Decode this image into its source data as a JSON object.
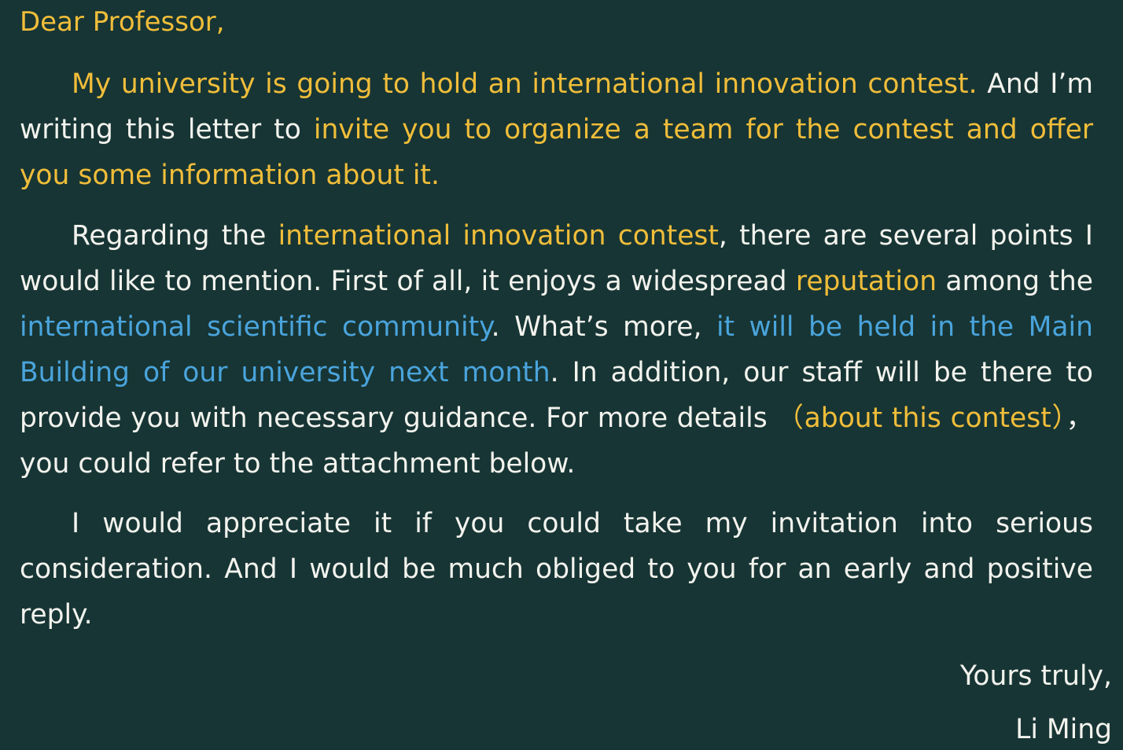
{
  "colors": {
    "background": "#173534",
    "text": "#f3f3ee",
    "highlight_yellow": "#f0bd3a",
    "highlight_blue": "#4aa4dc"
  },
  "letter": {
    "salutation": "Dear Professor,",
    "paragraph1": [
      {
        "text": "My university is going to hold an international innovation contest.",
        "style": "yellow"
      },
      {
        "text": " And I’m writing this letter to ",
        "style": "plain"
      },
      {
        "text": "invite you to organize a team for the contest and offer you some information about it.",
        "style": "yellow"
      }
    ],
    "paragraph2": [
      {
        "text": "Regarding the ",
        "style": "plain"
      },
      {
        "text": "international innovation contest",
        "style": "yellow"
      },
      {
        "text": ", there are several points I would like to mention. First of all, it enjoys a widespread ",
        "style": "plain"
      },
      {
        "text": "reputation",
        "style": "yellow"
      },
      {
        "text": " among the ",
        "style": "plain"
      },
      {
        "text": "international scientific community",
        "style": "blue"
      },
      {
        "text": ". What’s more, ",
        "style": "plain"
      },
      {
        "text": "it will be held in the Main Building of our university next month",
        "style": "blue"
      },
      {
        "text": ". In addition, our staff will be there to provide you with necessary guidance. For more details ",
        "style": "plain"
      },
      {
        "text": "（about this contest）",
        "style": "yellow"
      },
      {
        "text": "，you could refer to the attachment below.",
        "style": "plain"
      }
    ],
    "paragraph3": [
      {
        "text": "I would appreciate it if you could take my invitation into serious consideration. And I would be much obliged to you for an early and positive reply.",
        "style": "plain"
      }
    ],
    "closing": "Yours truly,",
    "signature": "Li Ming"
  }
}
